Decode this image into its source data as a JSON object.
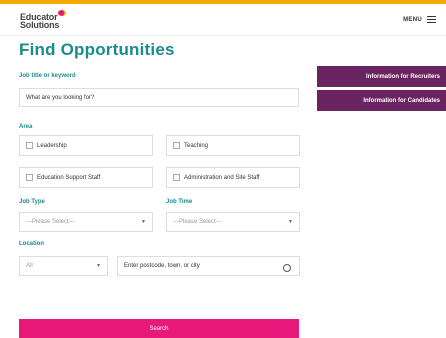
{
  "header": {
    "logo_line1": "Educator",
    "logo_line2": "Solutions",
    "menu_label": "MENU"
  },
  "page": {
    "title": "Find Opportunities"
  },
  "keyword": {
    "label": "Job title or keyword",
    "placeholder": "What are you looking for?"
  },
  "area": {
    "label": "Area",
    "options": [
      "Leadership",
      "Teaching",
      "Education Support Staff",
      "Administration and Site Staff"
    ]
  },
  "job_type": {
    "label": "Job Type",
    "value": "---Please Select---"
  },
  "job_time": {
    "label": "Job Time",
    "value": "---Please Select---"
  },
  "location": {
    "label": "Location",
    "scope_value": "All",
    "placeholder": "Enter postcode, town, or city"
  },
  "side": {
    "recruiters": "Information for Recruiters",
    "candidates": "Information for Candidates"
  },
  "search_label": "Search",
  "colors": {
    "accent": "#1a8b8e",
    "brand_pink": "#e8197a",
    "brand_purple": "#6b2462",
    "top_bar": "#f2a900"
  },
  "icons": {
    "menu": "hamburger-icon",
    "locate": "crosshair-icon",
    "dropdown": "chevron-down-icon"
  }
}
